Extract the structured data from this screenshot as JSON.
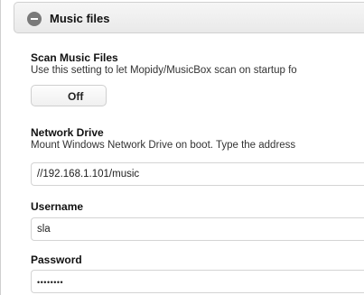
{
  "section": {
    "title": "Music files"
  },
  "scan": {
    "label": "Scan Music Files",
    "description": "Use this setting to let Mopidy/MusicBox scan on startup fo",
    "toggle_value": "Off"
  },
  "network_drive": {
    "label": "Network Drive",
    "description": "Mount Windows Network Drive on boot. Type the address",
    "value": "//192.168.1.101/music"
  },
  "username": {
    "label": "Username",
    "value": "sla"
  },
  "password": {
    "label": "Password",
    "value": "••••••••"
  }
}
